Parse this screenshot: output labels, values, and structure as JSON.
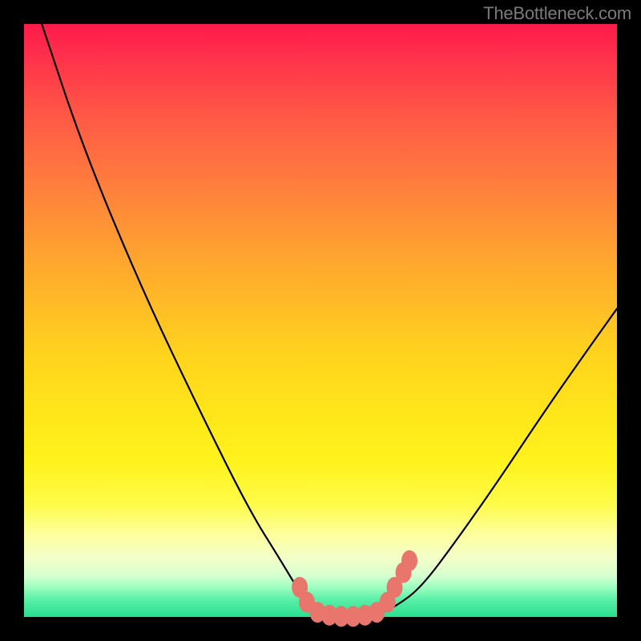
{
  "watermark": "TheBottleneck.com",
  "chart_data": {
    "type": "line",
    "title": "",
    "xlabel": "",
    "ylabel": "",
    "xlim": [
      0,
      100
    ],
    "ylim": [
      0,
      100
    ],
    "grid": false,
    "legend": false,
    "series": [
      {
        "name": "bottleneck-curve",
        "x": [
          3,
          10,
          20,
          30,
          38,
          43,
          46,
          48,
          50,
          53,
          57,
          60,
          63,
          67,
          73,
          80,
          88,
          95,
          100
        ],
        "y": [
          100,
          79,
          55,
          34,
          18,
          10,
          5,
          2,
          0.5,
          0,
          0,
          0.5,
          2,
          5,
          13,
          23,
          35,
          45,
          52
        ]
      }
    ],
    "annotations": {
      "trough_markers": {
        "color": "#e9766d",
        "points_x": [
          46.5,
          47.7,
          49.5,
          51.5,
          53.5,
          55.5,
          57.5,
          59.5,
          61.3,
          62.5,
          64.0,
          65.0
        ],
        "points_y": [
          5.0,
          2.5,
          0.8,
          0.3,
          0.1,
          0.1,
          0.3,
          0.8,
          2.5,
          5.0,
          7.5,
          9.5
        ]
      }
    }
  }
}
